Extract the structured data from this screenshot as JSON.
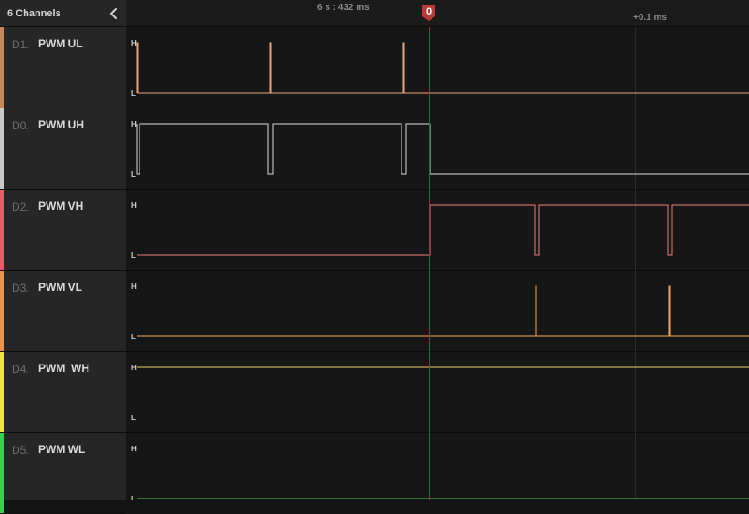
{
  "sidebar": {
    "title": "6 Channels",
    "collapse_icon": "chevron-left-icon"
  },
  "timeline": {
    "time_label": "6 s : 432 ms",
    "offset_label": "+0.1 ms",
    "marker_label": "0",
    "marker_color": "#b83a3a"
  },
  "level_labels": {
    "high": "H",
    "low": "L"
  },
  "channels": [
    {
      "id": "D1.",
      "name": "PWM UL",
      "color": "#c8875a",
      "trace_color": "#e9a47a",
      "initial": 0,
      "edges": [
        12,
        13,
        158,
        159,
        304,
        305
      ]
    },
    {
      "id": "D0.",
      "name": "PWM UH",
      "color": "#c9c9c9",
      "trace_color": "#d9d9d9",
      "initial": 1,
      "edges": [
        12,
        15,
        156,
        161,
        302,
        307,
        333
      ]
    },
    {
      "id": "D2.",
      "name": "PWM VH",
      "color": "#e85a68",
      "trace_color": "#f07b7b",
      "initial": 0,
      "edges": [
        333,
        448,
        453,
        594,
        599
      ]
    },
    {
      "id": "D3.",
      "name": "PWM VL",
      "color": "#f0924a",
      "trace_color": "#f5a55a",
      "initial": 0,
      "edges": [
        449,
        450,
        595,
        596
      ]
    },
    {
      "id": "D4.",
      "name": "PWM  WH",
      "color": "#efe63c",
      "trace_color": "#e8d36a",
      "initial": 1,
      "edges": []
    },
    {
      "id": "D5.",
      "name": "PWM WL",
      "color": "#3ecf4a",
      "trace_color": "#48d25a",
      "initial": 0,
      "edges": []
    }
  ]
}
